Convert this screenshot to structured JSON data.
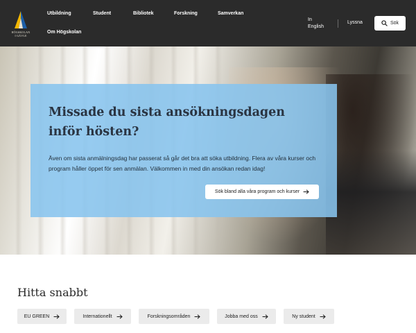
{
  "header": {
    "logo": {
      "line1": "HÖGSKOLAN",
      "line2": "I GÄVLE"
    },
    "nav": [
      "Utbildning",
      "Student",
      "Bibliotek",
      "Forskning",
      "Samverkan",
      "Om Högskolan"
    ],
    "lang": {
      "line1": "In",
      "line2": "English"
    },
    "listen": "Lyssna",
    "search": "Sök"
  },
  "hero": {
    "title": "Missade du sista ansökningsdagen inför hösten?",
    "body": "Även om sista anmälningsdag har passerat så går det bra att söka utbildning. Flera av våra kurser och program håller öppet för sen anmälan. Välkommen in med din ansökan redan idag!",
    "cta": "Sök bland alla våra program och kurser"
  },
  "quick": {
    "title": "Hitta snabbt",
    "links": [
      "EU GREEN",
      "Internationellt",
      "Forskningsområden",
      "Jobba med oss",
      "Ny student"
    ]
  },
  "colors": {
    "header_bg": "#2b2b2b",
    "card_bg": "#87c4ee",
    "chip_bg": "#ebebeb",
    "logo_blue": "#1d5fa8",
    "logo_yellow": "#f2b600"
  },
  "icons": {
    "search": "search-icon",
    "arrow": "arrow-right-icon"
  }
}
